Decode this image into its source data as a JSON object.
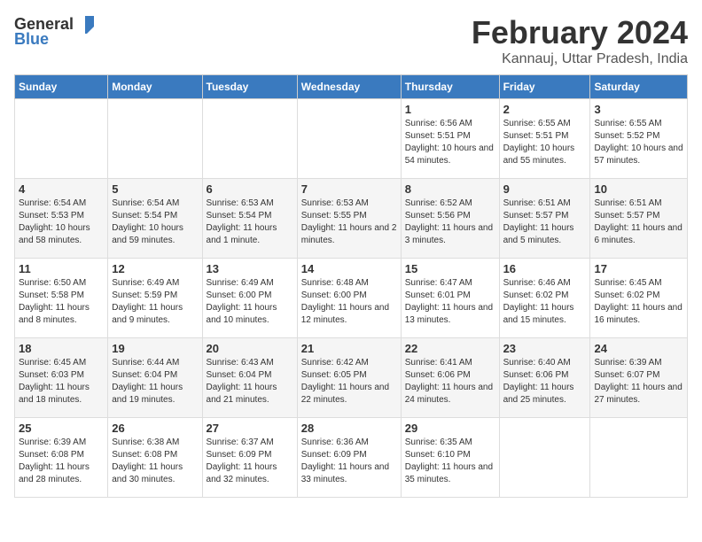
{
  "logo": {
    "general": "General",
    "blue": "Blue"
  },
  "title": "February 2024",
  "subtitle": "Kannauj, Uttar Pradesh, India",
  "days_header": [
    "Sunday",
    "Monday",
    "Tuesday",
    "Wednesday",
    "Thursday",
    "Friday",
    "Saturday"
  ],
  "weeks": [
    [
      {
        "day": "",
        "info": ""
      },
      {
        "day": "",
        "info": ""
      },
      {
        "day": "",
        "info": ""
      },
      {
        "day": "",
        "info": ""
      },
      {
        "day": "1",
        "info": "Sunrise: 6:56 AM\nSunset: 5:51 PM\nDaylight: 10 hours and 54 minutes."
      },
      {
        "day": "2",
        "info": "Sunrise: 6:55 AM\nSunset: 5:51 PM\nDaylight: 10 hours and 55 minutes."
      },
      {
        "day": "3",
        "info": "Sunrise: 6:55 AM\nSunset: 5:52 PM\nDaylight: 10 hours and 57 minutes."
      }
    ],
    [
      {
        "day": "4",
        "info": "Sunrise: 6:54 AM\nSunset: 5:53 PM\nDaylight: 10 hours and 58 minutes."
      },
      {
        "day": "5",
        "info": "Sunrise: 6:54 AM\nSunset: 5:54 PM\nDaylight: 10 hours and 59 minutes."
      },
      {
        "day": "6",
        "info": "Sunrise: 6:53 AM\nSunset: 5:54 PM\nDaylight: 11 hours and 1 minute."
      },
      {
        "day": "7",
        "info": "Sunrise: 6:53 AM\nSunset: 5:55 PM\nDaylight: 11 hours and 2 minutes."
      },
      {
        "day": "8",
        "info": "Sunrise: 6:52 AM\nSunset: 5:56 PM\nDaylight: 11 hours and 3 minutes."
      },
      {
        "day": "9",
        "info": "Sunrise: 6:51 AM\nSunset: 5:57 PM\nDaylight: 11 hours and 5 minutes."
      },
      {
        "day": "10",
        "info": "Sunrise: 6:51 AM\nSunset: 5:57 PM\nDaylight: 11 hours and 6 minutes."
      }
    ],
    [
      {
        "day": "11",
        "info": "Sunrise: 6:50 AM\nSunset: 5:58 PM\nDaylight: 11 hours and 8 minutes."
      },
      {
        "day": "12",
        "info": "Sunrise: 6:49 AM\nSunset: 5:59 PM\nDaylight: 11 hours and 9 minutes."
      },
      {
        "day": "13",
        "info": "Sunrise: 6:49 AM\nSunset: 6:00 PM\nDaylight: 11 hours and 10 minutes."
      },
      {
        "day": "14",
        "info": "Sunrise: 6:48 AM\nSunset: 6:00 PM\nDaylight: 11 hours and 12 minutes."
      },
      {
        "day": "15",
        "info": "Sunrise: 6:47 AM\nSunset: 6:01 PM\nDaylight: 11 hours and 13 minutes."
      },
      {
        "day": "16",
        "info": "Sunrise: 6:46 AM\nSunset: 6:02 PM\nDaylight: 11 hours and 15 minutes."
      },
      {
        "day": "17",
        "info": "Sunrise: 6:45 AM\nSunset: 6:02 PM\nDaylight: 11 hours and 16 minutes."
      }
    ],
    [
      {
        "day": "18",
        "info": "Sunrise: 6:45 AM\nSunset: 6:03 PM\nDaylight: 11 hours and 18 minutes."
      },
      {
        "day": "19",
        "info": "Sunrise: 6:44 AM\nSunset: 6:04 PM\nDaylight: 11 hours and 19 minutes."
      },
      {
        "day": "20",
        "info": "Sunrise: 6:43 AM\nSunset: 6:04 PM\nDaylight: 11 hours and 21 minutes."
      },
      {
        "day": "21",
        "info": "Sunrise: 6:42 AM\nSunset: 6:05 PM\nDaylight: 11 hours and 22 minutes."
      },
      {
        "day": "22",
        "info": "Sunrise: 6:41 AM\nSunset: 6:06 PM\nDaylight: 11 hours and 24 minutes."
      },
      {
        "day": "23",
        "info": "Sunrise: 6:40 AM\nSunset: 6:06 PM\nDaylight: 11 hours and 25 minutes."
      },
      {
        "day": "24",
        "info": "Sunrise: 6:39 AM\nSunset: 6:07 PM\nDaylight: 11 hours and 27 minutes."
      }
    ],
    [
      {
        "day": "25",
        "info": "Sunrise: 6:39 AM\nSunset: 6:08 PM\nDaylight: 11 hours and 28 minutes."
      },
      {
        "day": "26",
        "info": "Sunrise: 6:38 AM\nSunset: 6:08 PM\nDaylight: 11 hours and 30 minutes."
      },
      {
        "day": "27",
        "info": "Sunrise: 6:37 AM\nSunset: 6:09 PM\nDaylight: 11 hours and 32 minutes."
      },
      {
        "day": "28",
        "info": "Sunrise: 6:36 AM\nSunset: 6:09 PM\nDaylight: 11 hours and 33 minutes."
      },
      {
        "day": "29",
        "info": "Sunrise: 6:35 AM\nSunset: 6:10 PM\nDaylight: 11 hours and 35 minutes."
      },
      {
        "day": "",
        "info": ""
      },
      {
        "day": "",
        "info": ""
      }
    ]
  ]
}
